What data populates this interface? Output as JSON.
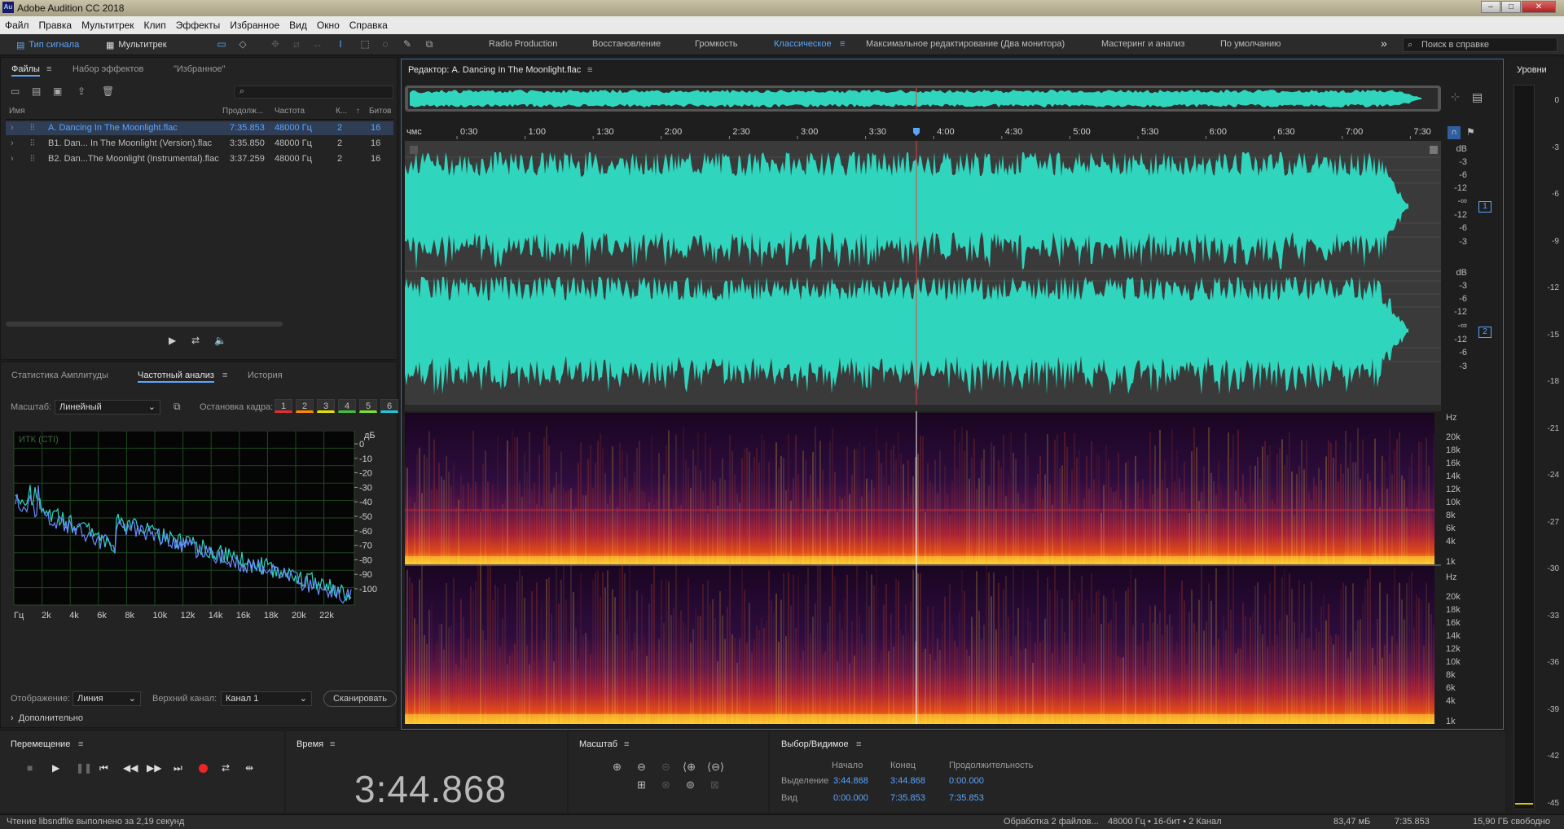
{
  "app": {
    "title": "Adobe Audition CC 2018",
    "logo": "Au"
  },
  "menu": [
    "Файл",
    "Правка",
    "Мультитрек",
    "Клип",
    "Эффекты",
    "Избранное",
    "Вид",
    "Окно",
    "Справка"
  ],
  "toolbar": {
    "waveform": "Тип сигнала",
    "multitrack": "Мультитрек"
  },
  "workspaces": [
    "Radio Production",
    "Восстановление",
    "Громкость",
    "Классическое",
    "Максимальное редактирование (Два монитора)",
    "Мастеринг и анализ",
    "По умолчанию"
  ],
  "active_workspace": "Классическое",
  "help_search": "Поиск в справке",
  "files_panel": {
    "tabs": [
      "Файлы",
      "Набор эффектов",
      "\"Избранное\""
    ],
    "columns": [
      "Имя",
      "Продолж...",
      "Частота",
      "К...",
      "Битов"
    ],
    "rows": [
      {
        "name": "A. Dancing In The Moonlight.flac",
        "duration": "7:35.853",
        "rate": "48000 Гц",
        "ch": "2",
        "bits": "16"
      },
      {
        "name": "B1. Dan... In The Moonlight (Version).flac",
        "duration": "3:35.850",
        "rate": "48000 Гц",
        "ch": "2",
        "bits": "16"
      },
      {
        "name": "B2. Dan...The Moonlight (Instrumental).flac",
        "duration": "3:37.259",
        "rate": "48000 Гц",
        "ch": "2",
        "bits": "16"
      }
    ]
  },
  "analysis_panel": {
    "tabs": [
      "Статистика Амплитуды",
      "Частотный анализ",
      "История"
    ],
    "scale_label": "Масштаб:",
    "scale_value": "Линейный",
    "freeze_label": "Остановка кадра:",
    "freeze_buttons": [
      "1",
      "2",
      "3",
      "4",
      "5",
      "6"
    ],
    "display_label": "Отображение:",
    "display_value": "Линия",
    "channel_label": "Верхний канал:",
    "channel_value": "Канал 1",
    "scan_button": "Сканировать",
    "advanced": "Дополнительно",
    "graph_label": "ИТК (СТI)"
  },
  "spectrum_chart": {
    "type": "line",
    "x_ticks": [
      "Гц",
      "2k",
      "4k",
      "6k",
      "8k",
      "10k",
      "12k",
      "14k",
      "16k",
      "18k",
      "20k",
      "22k"
    ],
    "y_unit": "дБ",
    "y_ticks": [
      "0",
      "-10",
      "-20",
      "-30",
      "-40",
      "-50",
      "-60",
      "-70",
      "-80",
      "-90",
      "-100"
    ]
  },
  "editor": {
    "title": "Редактор: A. Dancing In The Moonlight.flac",
    "time_ticks": [
      "чмс",
      "0:30",
      "1:00",
      "1:30",
      "2:00",
      "2:30",
      "3:00",
      "3:30",
      "4:00",
      "4:30",
      "5:00",
      "5:30",
      "6:00",
      "6:30",
      "7:00",
      "7:30"
    ],
    "db_scale": [
      "dB",
      "-3",
      "-6",
      "-12",
      "-∞",
      "-12",
      "-6",
      "-3"
    ],
    "hz_scale": [
      "Hz",
      "20k",
      "18k",
      "16k",
      "14k",
      "12k",
      "10k",
      "8k",
      "6k",
      "4k",
      "1k"
    ],
    "channels": [
      "1",
      "2"
    ]
  },
  "levels": {
    "title": "Уровни",
    "scale": [
      "0",
      "-3",
      "-6",
      "-9",
      "-12",
      "-15",
      "-18",
      "-21",
      "-24",
      "-27",
      "-30",
      "-33",
      "-36",
      "-39",
      "-42",
      "-45"
    ]
  },
  "transport": {
    "title": "Перемещение"
  },
  "time_panel": {
    "title": "Время",
    "value": "3:44.868"
  },
  "zoom_panel": {
    "title": "Масштаб"
  },
  "selection_panel": {
    "title": "Выбор/Видимое",
    "cols": [
      "Начало",
      "Конец",
      "Продолжительность"
    ],
    "rows": [
      {
        "label": "Выделение",
        "start": "3:44.868",
        "end": "3:44.868",
        "dur": "0:00.000"
      },
      {
        "label": "Вид",
        "start": "0:00.000",
        "end": "7:35.853",
        "dur": "7:35.853"
      }
    ]
  },
  "status": {
    "left": "Чтение libsndfile выполнено за 2,19 секунд",
    "processing": "Обработка 2 файлов...",
    "format": "48000 Гц • 16-бит • 2 Канал",
    "size": "83,47 мБ",
    "duration": "7:35.853",
    "free": "15,90 ГБ свободно"
  },
  "colors": {
    "accent": "#5aa6ff",
    "waveform": "#2fd6bd",
    "playhead": "#e04040"
  }
}
